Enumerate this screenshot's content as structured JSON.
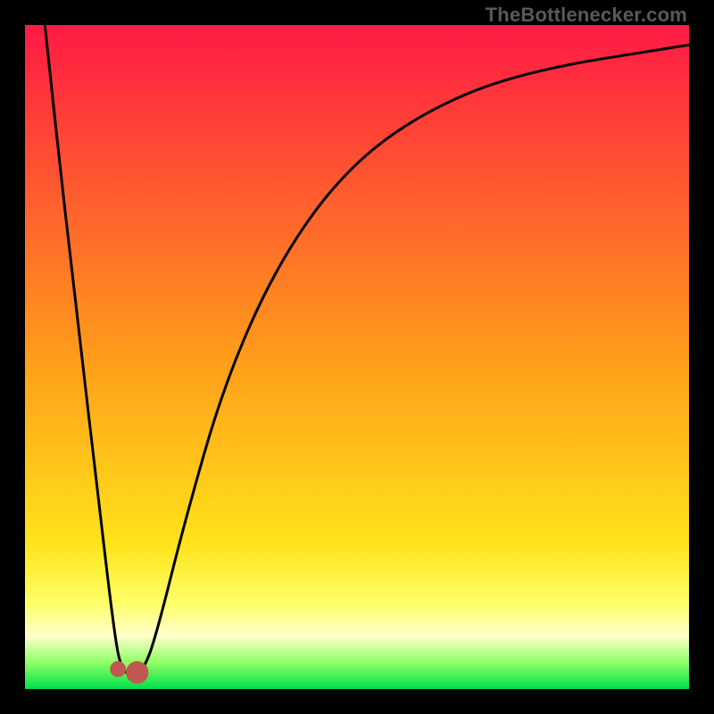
{
  "watermark": "TheBottlenecker.com",
  "chart_data": {
    "type": "line",
    "title": "",
    "xlabel": "",
    "ylabel": "",
    "xlim": [
      0,
      100
    ],
    "ylim": [
      0,
      100
    ],
    "background_gradient": {
      "stops": [
        {
          "offset": 0.0,
          "color": "#ff1a44"
        },
        {
          "offset": 0.5,
          "color": "#ff9c1a"
        },
        {
          "offset": 0.78,
          "color": "#ffe31a"
        },
        {
          "offset": 0.87,
          "color": "#ffff66"
        },
        {
          "offset": 0.92,
          "color": "#ffffcc"
        },
        {
          "offset": 0.96,
          "color": "#8fff66"
        },
        {
          "offset": 1.0,
          "color": "#00e04a"
        }
      ]
    },
    "series": [
      {
        "name": "bottleneck-curve",
        "stroke": "#000000",
        "stroke_width": 3,
        "points": [
          {
            "x": 3.0,
            "y": 100.0
          },
          {
            "x": 5.0,
            "y": 81.0
          },
          {
            "x": 8.0,
            "y": 55.0
          },
          {
            "x": 11.0,
            "y": 29.0
          },
          {
            "x": 13.5,
            "y": 8.0
          },
          {
            "x": 14.5,
            "y": 3.0
          },
          {
            "x": 16.0,
            "y": 2.0
          },
          {
            "x": 18.0,
            "y": 3.0
          },
          {
            "x": 20.0,
            "y": 9.0
          },
          {
            "x": 24.0,
            "y": 25.0
          },
          {
            "x": 30.0,
            "y": 46.0
          },
          {
            "x": 38.0,
            "y": 64.0
          },
          {
            "x": 48.0,
            "y": 78.0
          },
          {
            "x": 60.0,
            "y": 87.0
          },
          {
            "x": 75.0,
            "y": 93.0
          },
          {
            "x": 100.0,
            "y": 97.0
          }
        ]
      }
    ],
    "marker": {
      "color": "#c1584f",
      "dot": {
        "cx": 14.0,
        "cy": 3.0,
        "r": 1.2
      },
      "bar": {
        "x": 15.2,
        "y0": 0.8,
        "y1": 4.2,
        "width": 3.4
      }
    }
  }
}
